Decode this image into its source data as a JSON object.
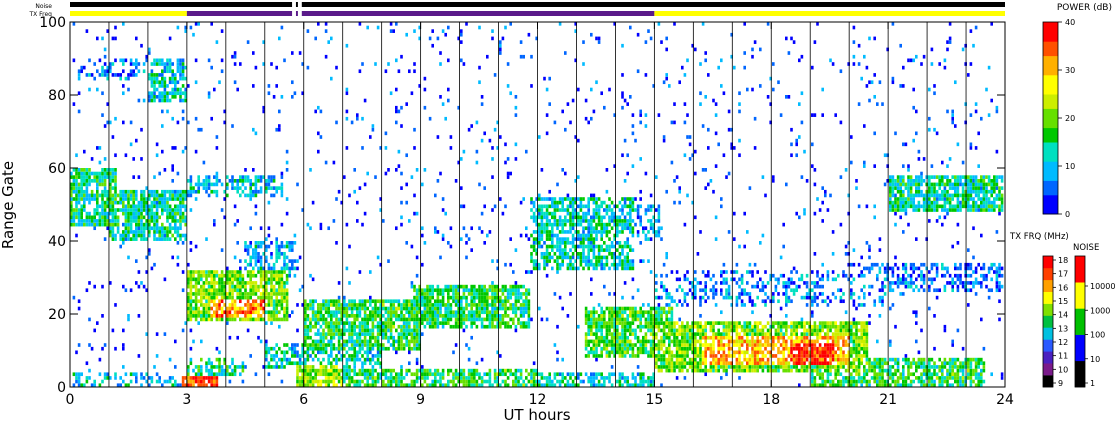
{
  "chart_data": {
    "type": "heatmap",
    "xlabel": "UT hours",
    "ylabel": "Range Gate",
    "xlim": [
      0,
      24
    ],
    "ylim": [
      0,
      100
    ],
    "x_ticks": [
      0,
      3,
      6,
      9,
      12,
      15,
      18,
      21,
      24
    ],
    "y_ticks": [
      0,
      20,
      40,
      60,
      80,
      100
    ],
    "vertical_lines_ut": [
      1,
      2,
      3,
      4,
      5,
      6,
      7,
      8,
      9,
      10,
      11,
      12,
      13,
      14,
      15,
      16,
      17,
      18,
      19,
      20,
      21,
      22,
      23
    ],
    "status_bars": {
      "noise_label": "Noise",
      "txfreq_label": "TX Freq",
      "noise_segments": [
        {
          "start": 0,
          "end": 5.7,
          "color": "#000000"
        },
        {
          "start": 5.8,
          "end": 5.85,
          "color": "#000000"
        },
        {
          "start": 5.95,
          "end": 24,
          "color": "#000000"
        }
      ],
      "txfreq_segments": [
        {
          "start": 0,
          "end": 3.0,
          "color": "#ffff00"
        },
        {
          "start": 3.0,
          "end": 5.7,
          "color": "#5a1a8a"
        },
        {
          "start": 5.8,
          "end": 5.85,
          "color": "#5a1a8a"
        },
        {
          "start": 5.95,
          "end": 15.0,
          "color": "#5a1a8a"
        },
        {
          "start": 15.0,
          "end": 24,
          "color": "#ffff00"
        }
      ]
    },
    "power_scale": {
      "title": "POWER (dB)",
      "min": 0,
      "max": 40,
      "ticks": [
        0,
        10,
        20,
        30,
        40
      ],
      "colors": [
        "#0000ff",
        "#0066ff",
        "#00bbff",
        "#00e0c0",
        "#00c800",
        "#66e000",
        "#ccee00",
        "#ffff00",
        "#ffb000",
        "#ff5000",
        "#ff0000"
      ]
    },
    "txfreq_scale": {
      "title": "TX FRQ (MHz)",
      "ticks": [
        9,
        10,
        11,
        12,
        13,
        14,
        15,
        16,
        17,
        18
      ],
      "colors": [
        "#000000",
        "#7a1a8a",
        "#4a20c0",
        "#2a5aff",
        "#00c0e0",
        "#00c040",
        "#80e000",
        "#ffff00",
        "#ffa000",
        "#ff4000",
        "#ff0000"
      ]
    },
    "noise_scale": {
      "title": "NOISE",
      "ticks": [
        "1",
        "10",
        "100",
        "1000",
        "10000"
      ],
      "colors": [
        "#000000",
        "#0000ff",
        "#00c000",
        "#ffff00",
        "#ff0000"
      ]
    },
    "echo_regions": [
      {
        "x0": 0.0,
        "x1": 1.2,
        "y0": 44,
        "y1": 60,
        "power": 14,
        "density": 0.85
      },
      {
        "x0": 1.0,
        "x1": 3.0,
        "y0": 40,
        "y1": 54,
        "power": 13,
        "density": 0.8
      },
      {
        "x0": 2.0,
        "x1": 3.0,
        "y0": 78,
        "y1": 90,
        "power": 11,
        "density": 0.65
      },
      {
        "x0": 0.2,
        "x1": 2.5,
        "y0": 84,
        "y1": 90,
        "power": 6,
        "density": 0.3
      },
      {
        "x0": 3.0,
        "x1": 5.5,
        "y0": 52,
        "y1": 58,
        "power": 10,
        "density": 0.55
      },
      {
        "x0": 3.0,
        "x1": 5.6,
        "y0": 18,
        "y1": 32,
        "power": 20,
        "density": 0.85
      },
      {
        "x0": 3.6,
        "x1": 5.0,
        "y0": 19,
        "y1": 24,
        "power": 32,
        "density": 0.7
      },
      {
        "x0": 4.5,
        "x1": 5.8,
        "y0": 30,
        "y1": 40,
        "power": 9,
        "density": 0.5
      },
      {
        "x0": 2.9,
        "x1": 3.8,
        "y0": 0,
        "y1": 3,
        "power": 36,
        "density": 0.9
      },
      {
        "x0": 3.0,
        "x1": 4.5,
        "y0": 3,
        "y1": 8,
        "power": 14,
        "density": 0.55
      },
      {
        "x0": 5.8,
        "x1": 7.0,
        "y0": 0,
        "y1": 6,
        "power": 22,
        "density": 0.8
      },
      {
        "x0": 6.0,
        "x1": 12.0,
        "y0": 0,
        "y1": 5,
        "power": 16,
        "density": 0.7
      },
      {
        "x0": 6.0,
        "x1": 9.0,
        "y0": 10,
        "y1": 24,
        "power": 16,
        "density": 0.8
      },
      {
        "x0": 8.8,
        "x1": 11.8,
        "y0": 16,
        "y1": 28,
        "power": 16,
        "density": 0.8
      },
      {
        "x0": 5.0,
        "x1": 8.0,
        "y0": 5,
        "y1": 12,
        "power": 12,
        "density": 0.55
      },
      {
        "x0": 11.8,
        "x1": 14.5,
        "y0": 32,
        "y1": 52,
        "power": 12,
        "density": 0.7
      },
      {
        "x0": 13.0,
        "x1": 15.2,
        "y0": 40,
        "y1": 50,
        "power": 8,
        "density": 0.5
      },
      {
        "x0": 13.2,
        "x1": 15.5,
        "y0": 8,
        "y1": 22,
        "power": 17,
        "density": 0.8
      },
      {
        "x0": 15.0,
        "x1": 20.5,
        "y0": 4,
        "y1": 18,
        "power": 20,
        "density": 0.85
      },
      {
        "x0": 16.2,
        "x1": 20.0,
        "y0": 6,
        "y1": 14,
        "power": 30,
        "density": 0.75
      },
      {
        "x0": 18.5,
        "x1": 19.6,
        "y0": 6,
        "y1": 12,
        "power": 37,
        "density": 0.85
      },
      {
        "x0": 19.0,
        "x1": 23.5,
        "y0": 0,
        "y1": 8,
        "power": 16,
        "density": 0.75
      },
      {
        "x0": 15.0,
        "x1": 21.0,
        "y0": 22,
        "y1": 32,
        "power": 7,
        "density": 0.35
      },
      {
        "x0": 21.0,
        "x1": 24.0,
        "y0": 48,
        "y1": 58,
        "power": 13,
        "density": 0.85
      },
      {
        "x0": 20.0,
        "x1": 24.0,
        "y0": 26,
        "y1": 34,
        "power": 6,
        "density": 0.45
      },
      {
        "x0": 12.0,
        "x1": 15.0,
        "y0": 0,
        "y1": 4,
        "power": 12,
        "density": 0.6
      },
      {
        "x0": 0.0,
        "x1": 3.0,
        "y0": 0,
        "y1": 4,
        "power": 10,
        "density": 0.35
      },
      {
        "x0": 0.0,
        "x1": 24.0,
        "y0": 0,
        "y1": 100,
        "power": 4,
        "density": 0.04
      }
    ]
  }
}
